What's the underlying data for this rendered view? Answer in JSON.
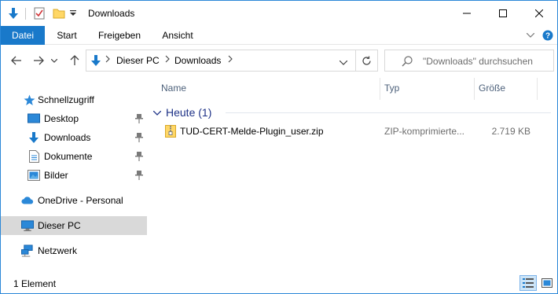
{
  "window": {
    "title": "Downloads"
  },
  "ribbon": {
    "tabs": [
      {
        "label": "Datei"
      },
      {
        "label": "Start"
      },
      {
        "label": "Freigeben"
      },
      {
        "label": "Ansicht"
      }
    ]
  },
  "address": {
    "crumbs": [
      {
        "label": "Dieser PC"
      },
      {
        "label": "Downloads"
      }
    ]
  },
  "search": {
    "placeholder": "\"Downloads\" durchsuchen"
  },
  "sidebar": {
    "items": [
      {
        "label": "Schnellzugriff",
        "icon": "star-icon"
      },
      {
        "label": "Desktop",
        "icon": "desktop-folder-icon",
        "pinned": true
      },
      {
        "label": "Downloads",
        "icon": "download-arrow-icon",
        "pinned": true
      },
      {
        "label": "Dokumente",
        "icon": "document-icon",
        "pinned": true
      },
      {
        "label": "Bilder",
        "icon": "picture-icon",
        "pinned": true
      },
      {
        "label": "OneDrive - Personal",
        "icon": "cloud-icon"
      },
      {
        "label": "Dieser PC",
        "icon": "monitor-icon",
        "selected": true
      },
      {
        "label": "Netzwerk",
        "icon": "network-icon"
      }
    ]
  },
  "columns": {
    "name": "Name",
    "type": "Typ",
    "size": "Größe"
  },
  "groups": [
    {
      "label": "Heute (1)",
      "files": [
        {
          "name": "TUD-CERT-Melde-Plugin_user.zip",
          "type": "ZIP-komprimierte...",
          "size": "2.719 KB",
          "icon": "zip-folder-icon"
        }
      ]
    }
  ],
  "status": {
    "text": "1 Element"
  },
  "colors": {
    "accent": "#1979ca",
    "selected": "#d9d9d9",
    "group_text": "#1e3287"
  }
}
